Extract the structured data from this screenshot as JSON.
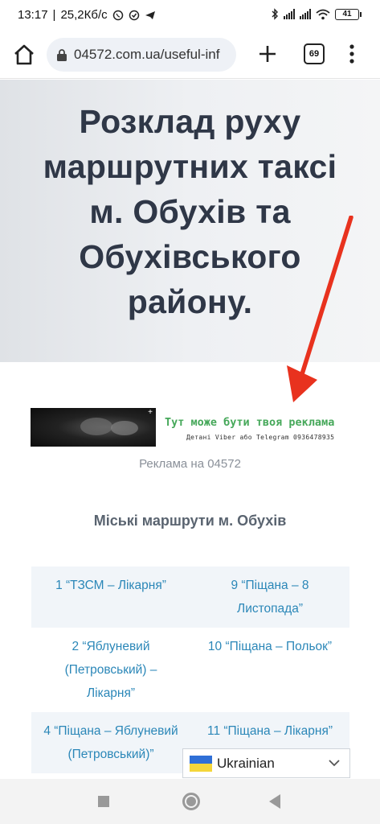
{
  "status_bar": {
    "time": "13:17",
    "speed": "25,2Кб/с",
    "battery": "41"
  },
  "browser": {
    "url": "04572.com.ua/useful-inf",
    "tab_count": "69"
  },
  "hero": {
    "title": "Розклад руху маршрутних таксі м. Обухів та Обухівського району."
  },
  "ad": {
    "headline": "Тут може бути твоя реклама",
    "subline": "Детані Viber або Telegram 0936478935",
    "caption": "Реклама на 04572"
  },
  "section": {
    "title": "Міські маршрути м. Обухів"
  },
  "routes": [
    [
      "1 “ТЗСМ – Лікарня”",
      "9 “Піщана – 8 Листопада”"
    ],
    [
      "2 “Яблуневий (Петровський) – Лікарня”",
      "10 “Піщана – Польок”"
    ],
    [
      "4 “Піщана – Яблуневий (Петровський)”",
      "11 “Піщана – Лікарня”"
    ]
  ],
  "language": {
    "selected": "Ukrainian"
  },
  "colors": {
    "title": "#2f3747",
    "link": "#2b87b8",
    "ad_green": "#46a85a",
    "arrow": "#e8321e"
  }
}
